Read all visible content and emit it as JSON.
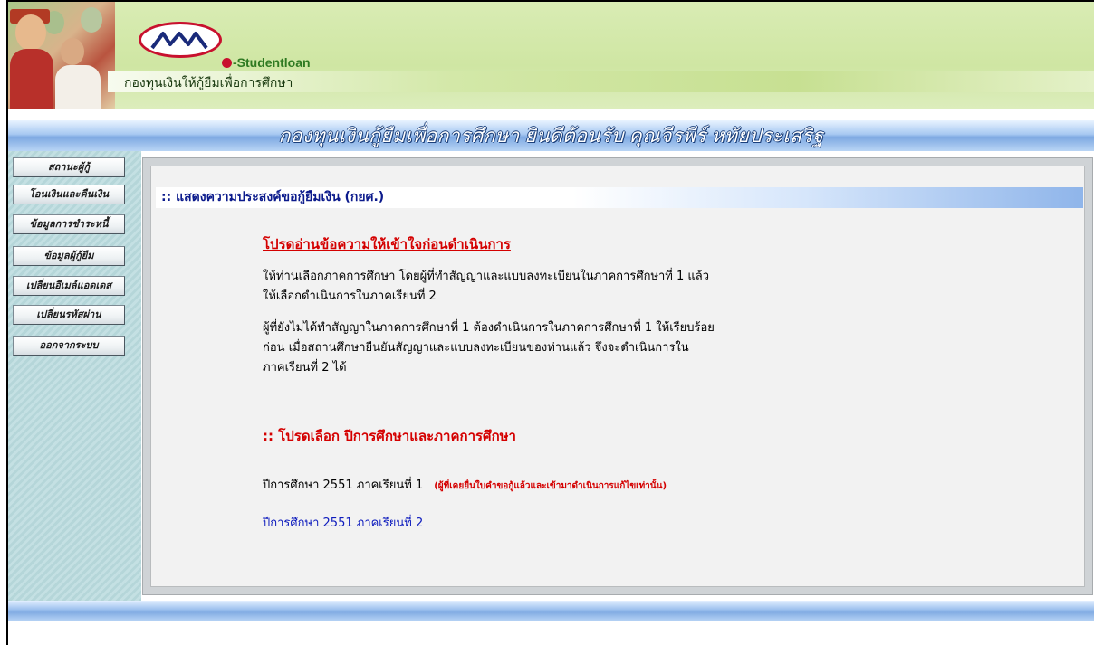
{
  "header": {
    "brand": "-Studentloan",
    "tagline": "กองทุนเงินให้กู้ยืมเพื่อการศึกษา",
    "welcome": "กองทุนเงินกู้ยืมเพื่อการศึกษา ยินดีต้อนรับ คุณจีรพีร์ หทัยประเสริฐ"
  },
  "sidebar": {
    "items": [
      {
        "label": "สถานะผู้กู้"
      },
      {
        "label": "โอนเงินและคืนเงิน"
      },
      {
        "label": "ข้อมูลการชำระหนี้"
      },
      {
        "label": "ข้อมูลผู้กู้ยืม"
      },
      {
        "label": "เปลี่ยนอีเมล์แอดเดส"
      },
      {
        "label": "เปลี่ยนรหัสผ่าน"
      },
      {
        "label": "ออกจากระบบ"
      }
    ]
  },
  "main": {
    "section_title": ":: แสดงความประสงค์ขอกู้ยืมเงิน (กยศ.)",
    "notice_heading": "โปรดอ่านข้อความให้เข้าใจก่อนดำเนินการ",
    "paragraph1": [
      "ให้ท่านเลือกภาคการศึกษา โดยผู้ที่ทำสัญญาและแบบลงทะเบียนในภาคการศึกษาที่ 1 แล้ว",
      "ให้เลือกดำเนินการในภาคเรียนที่ 2"
    ],
    "paragraph2": [
      "ผู้ที่ยังไม่ได้ทำสัญญาในภาคการศึกษาที่ 1 ต้องดำเนินการในภาคการศึกษาที่ 1 ให้เรียบร้อย",
      "ก่อน เมื่อสถานศึกษายืนยันสัญญาและแบบลงทะเบียนของท่านแล้ว จึงจะดำเนินการใน",
      "ภาคเรียนที่ 2 ได้"
    ],
    "select_heading": ":: โปรดเลือก ปีการศึกษาและภาคการศึกษา",
    "semester1": "ปีการศึกษา  2551  ภาคเรียนที่  1",
    "semester1_note": "(ผู้ที่เคยยื่นใบคำขอกู้แล้วและเข้ามาดำเนินการแก้ไขเท่านั้น)",
    "semester2": "ปีการศึกษา  2551  ภาคเรียนที่  2"
  },
  "colors": {
    "accent_red": "#d40000",
    "link_blue": "#0d1bbd",
    "title_navy": "#0b1a8c"
  }
}
